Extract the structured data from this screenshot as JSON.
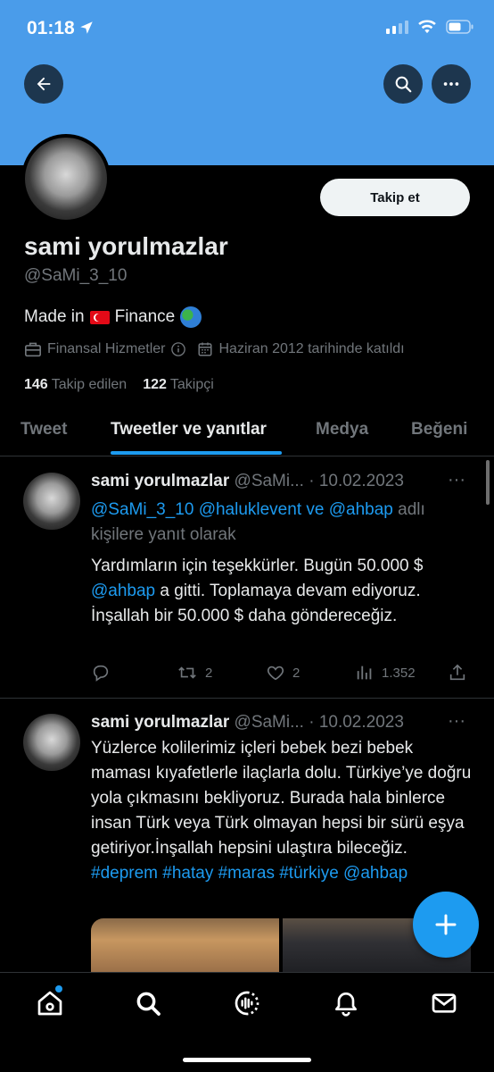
{
  "status_bar": {
    "time": "01:18"
  },
  "profile": {
    "name": "sami yorulmazlar",
    "handle": "@SaMi_3_10",
    "bio_prefix": "Made in",
    "bio_suffix": "Finance",
    "category": "Finansal Hizmetler",
    "joined": "Haziran 2012 tarihinde katıldı",
    "following_count": "146",
    "following_label": "Takip edilen",
    "followers_count": "122",
    "followers_label": "Takipçi",
    "follow_button": "Takip et"
  },
  "tabs": [
    {
      "label": "Tweet"
    },
    {
      "label": "Tweetler ve yanıtlar"
    },
    {
      "label": "Medya"
    },
    {
      "label": "Beğeni"
    }
  ],
  "tweets": [
    {
      "author": "sami yorulmazlar",
      "handle_date": "@SaMi... · 10.02.2023",
      "reply_links": "@SaMi_3_10 @haluklevent ve @ahbap",
      "reply_suffix": "adlı kişilere yanıt olarak",
      "text_before": "Yardımların için teşekkürler. Bugün 50.000 $",
      "text_link": "@ahbap",
      "text_after": "a gitti. Toplamaya devam ediyoruz. İnşallah bir 50.000 $ daha göndereceğiz.",
      "retweets": "2",
      "likes": "2",
      "views": "1.352"
    },
    {
      "author": "sami yorulmazlar",
      "handle_date": "@SaMi... · 10.02.2023",
      "text": "Yüzlerce kolilerimiz içleri bebek bezi bebek maması kıyafetlerle ilaçlarla dolu. Türkiye’ye doğru yola çıkmasını bekliyoruz. Burada hala binlerce insan Türk veya Türk olmayan hepsi bir sürü eşya getiriyor.İnşallah hepsini ulaştıra bileceğiz.",
      "hashtags": "#deprem #hatay #maras #türkiye @ahbap"
    }
  ],
  "colors": {
    "banner": "#4a9cea",
    "accent": "#1d9bf0",
    "background": "#000000"
  },
  "icons": [
    "back-arrow-icon",
    "search-icon",
    "more-icon",
    "briefcase-icon",
    "info-icon",
    "calendar-icon",
    "reply-icon",
    "retweet-icon",
    "like-icon",
    "views-icon",
    "share-icon",
    "compose-icon",
    "home-icon",
    "spaces-icon",
    "bell-icon",
    "mail-icon"
  ]
}
